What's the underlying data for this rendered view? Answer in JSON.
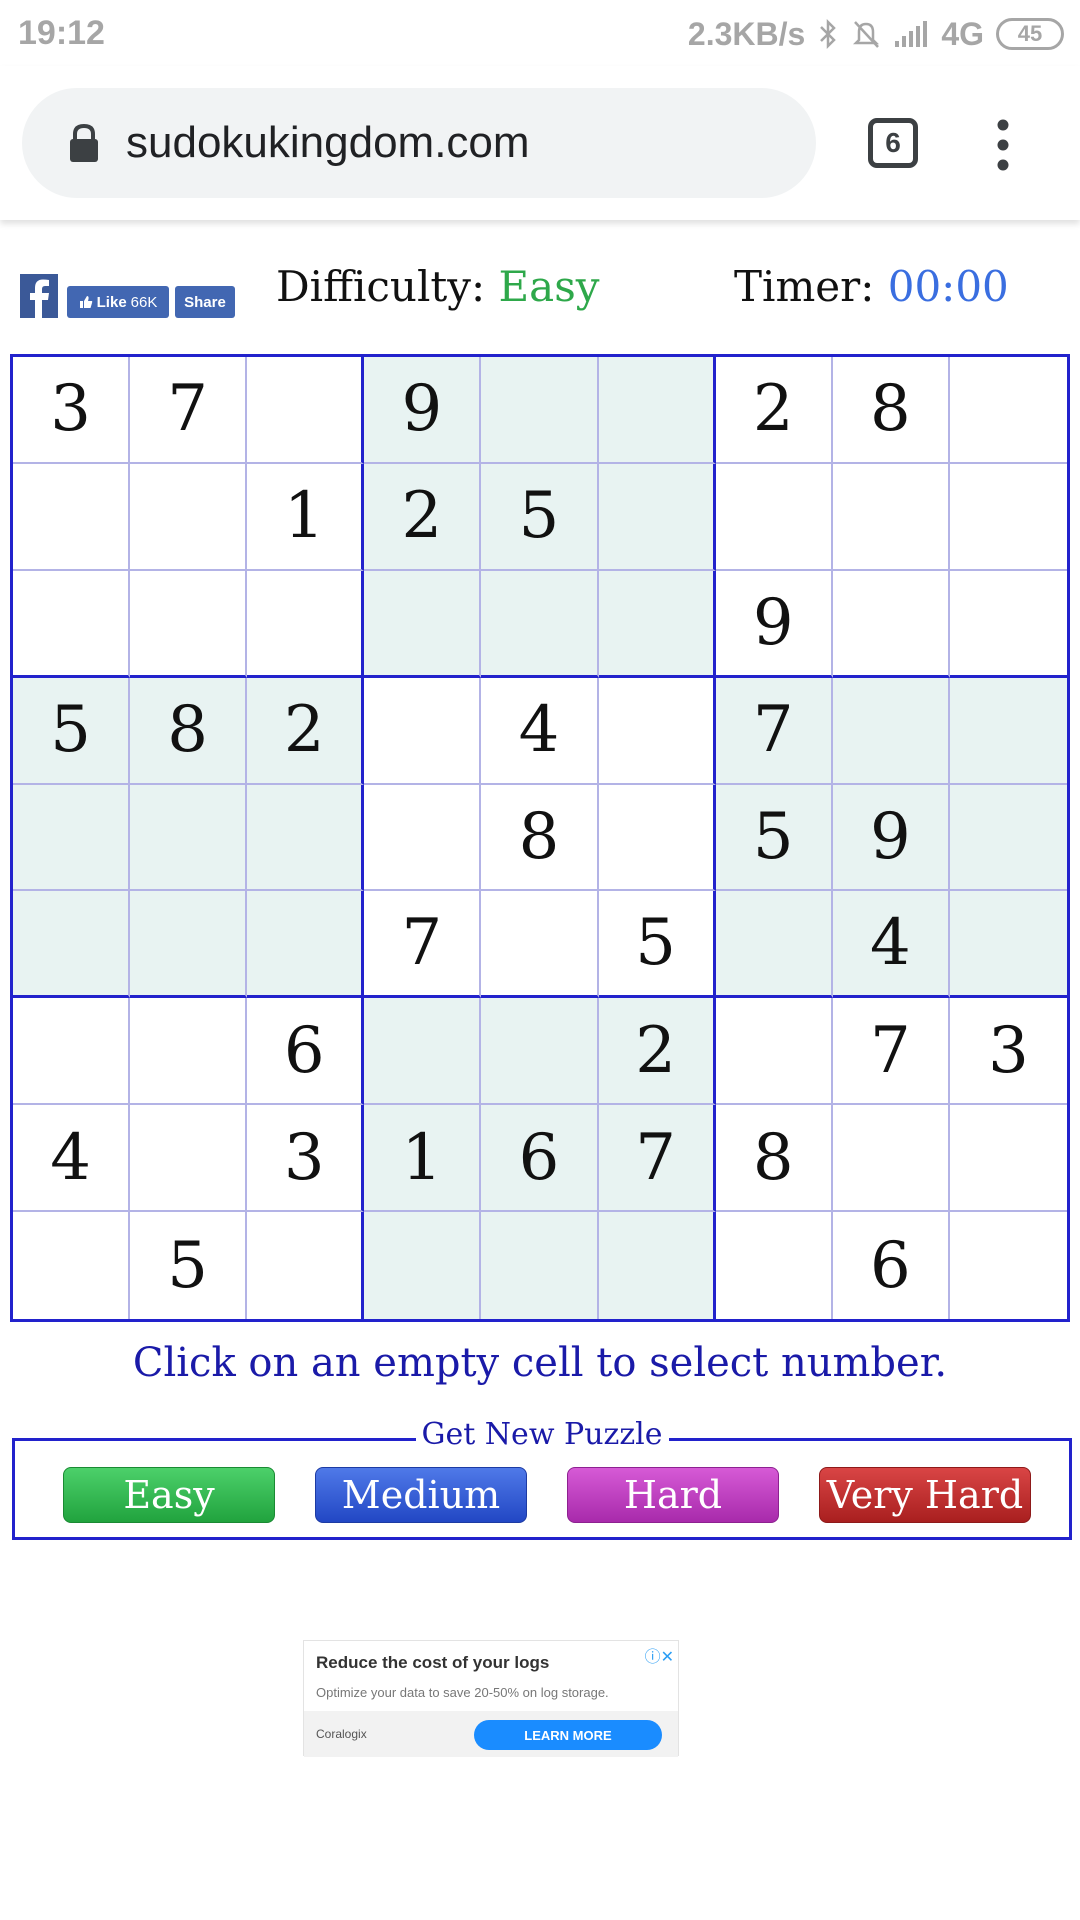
{
  "status_bar": {
    "time": "19:12",
    "speed": "2.3KB/s",
    "network": "4G",
    "battery": "45"
  },
  "browser": {
    "url": "sudokukingdom.com",
    "tab_count": "6"
  },
  "header": {
    "fb_like_label": "Like",
    "fb_like_count": "66K",
    "fb_share_label": "Share",
    "difficulty_label": "Difficulty:",
    "difficulty_value": "Easy",
    "timer_label": "Timer:",
    "timer_value": "00:00"
  },
  "board": {
    "rows": [
      [
        "3",
        "7",
        "",
        "9",
        "",
        "",
        "2",
        "8",
        ""
      ],
      [
        "",
        "",
        "1",
        "2",
        "5",
        "",
        "",
        "",
        ""
      ],
      [
        "",
        "",
        "",
        "",
        "",
        "",
        "9",
        "",
        ""
      ],
      [
        "5",
        "8",
        "2",
        "",
        "4",
        "",
        "7",
        "",
        ""
      ],
      [
        "",
        "",
        "",
        "",
        "8",
        "",
        "5",
        "9",
        ""
      ],
      [
        "",
        "",
        "",
        "7",
        "",
        "5",
        "",
        "4",
        ""
      ],
      [
        "",
        "",
        "6",
        "",
        "",
        "2",
        "",
        "7",
        "3"
      ],
      [
        "4",
        "",
        "3",
        "1",
        "6",
        "7",
        "8",
        "",
        ""
      ],
      [
        "",
        "5",
        "",
        "",
        "",
        "",
        "",
        "6",
        ""
      ]
    ]
  },
  "instruction": "Click on an empty cell to select number.",
  "new_puzzle": {
    "legend": "Get New Puzzle",
    "buttons": {
      "easy": "Easy",
      "medium": "Medium",
      "hard": "Hard",
      "very_hard": "Very Hard"
    }
  },
  "ad": {
    "title": "Reduce the cost of your logs",
    "description": "Optimize your data to save 20-50% on log storage.",
    "brand": "Coralogix",
    "cta": "LEARN MORE"
  },
  "colors": {
    "grid_border": "#2222cc",
    "box_shade": "#e8f3f2",
    "difficulty_easy": "#2ea84a",
    "timer": "#3a6ee0",
    "instruction": "#1a1aa8"
  }
}
